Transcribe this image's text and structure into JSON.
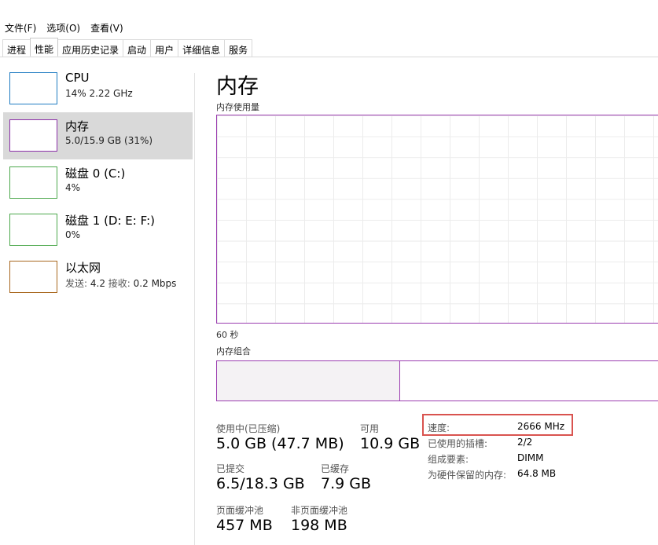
{
  "menu": [
    "文件(F)",
    "选项(O)",
    "查看(V)"
  ],
  "tabs": [
    "进程",
    "性能",
    "应用历史记录",
    "启动",
    "用户",
    "详细信息",
    "服务"
  ],
  "active_tab": "性能",
  "sidebar": {
    "items": [
      {
        "title": "CPU",
        "subtitle": "14% 2.22 GHz",
        "color": "#1f7cc2"
      },
      {
        "title": "内存",
        "subtitle": "5.0/15.9 GB (31%)",
        "color": "#8b2fa8"
      },
      {
        "title": "磁盘 0 (C:)",
        "subtitle": "4%",
        "color": "#4ca84c"
      },
      {
        "title": "磁盘 1 (D: E: F:)",
        "subtitle": "0%",
        "color": "#4ca84c"
      },
      {
        "title": "以太网",
        "send_label": "发送:",
        "send_value": "4.2",
        "recv_label": "接收:",
        "recv_value": "0.2 Mbps",
        "color": "#a8671e"
      }
    ]
  },
  "main": {
    "title": "内存",
    "usage_label": "内存使用量",
    "time_label": "60 秒",
    "composition_label": "内存组合",
    "composition_in_use_fraction": 0.31
  },
  "stats": {
    "in_use_label": "使用中(已压缩)",
    "in_use_value": "5.0 GB (47.7 MB)",
    "available_label": "可用",
    "available_value": "10.9 GB",
    "committed_label": "已提交",
    "committed_value": "6.5/18.3 GB",
    "cached_label": "已缓存",
    "cached_value": "7.9 GB",
    "paged_label": "页面缓冲池",
    "paged_value": "457 MB",
    "nonpaged_label": "非页面缓冲池",
    "nonpaged_value": "198 MB"
  },
  "specs": {
    "speed_label": "速度:",
    "speed_value": "2666 MHz",
    "slots_label": "已使用的插槽:",
    "slots_value": "2/2",
    "form_label": "组成要素:",
    "form_value": "DIMM",
    "reserved_label": "为硬件保留的内存:",
    "reserved_value": "64.8 MB"
  }
}
